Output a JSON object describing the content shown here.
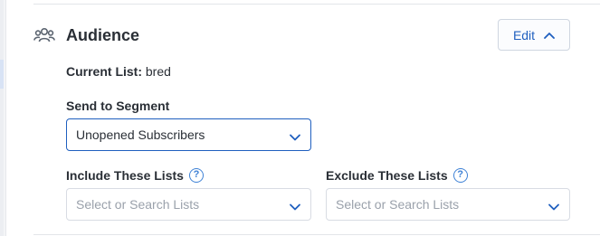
{
  "section": {
    "title": "Audience",
    "icon": "audience-icon",
    "edit_label": "Edit"
  },
  "current_list": {
    "label": "Current List:",
    "value": "bred"
  },
  "segment": {
    "label": "Send to Segment",
    "selected": "Unopened Subscribers"
  },
  "include_lists": {
    "label": "Include These Lists",
    "help": "?",
    "placeholder": "Select or Search Lists"
  },
  "exclude_lists": {
    "label": "Exclude These Lists",
    "help": "?",
    "placeholder": "Select or Search Lists"
  },
  "colors": {
    "accent": "#1f5fbf",
    "help_icon": "#3f82d6",
    "border": "#d8dce3",
    "placeholder": "#9aa1ab"
  }
}
